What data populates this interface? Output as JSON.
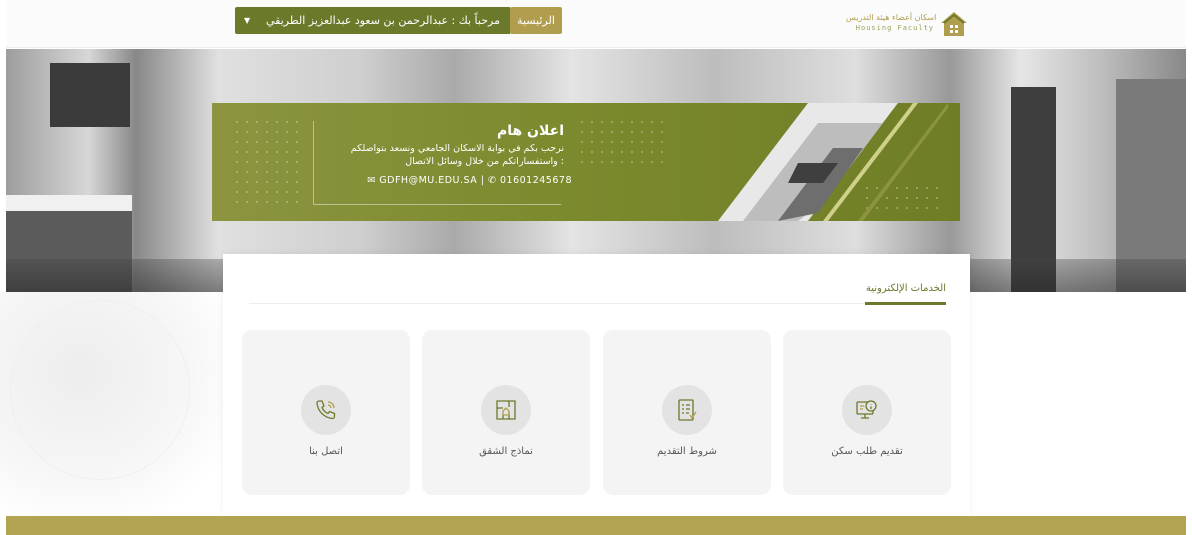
{
  "header": {
    "home_label": "الرئيسية",
    "welcome_label": "مرحباً بك : عبدالرحمن بن سعود عبدالعزيز الطريقي",
    "logo_ar": "اسكان أعضاء هيئة التدريس",
    "logo_en": "Housing Faculty"
  },
  "banner": {
    "title": "اعلان هام",
    "line1": "نرحب بكم في بوابة الاسكان الجامعي ونسعد بتواصلكم",
    "line2": "واستفساراتكم من خلال وسائل الاتصال :",
    "email": "GDFH@MU.EDU.SA",
    "phone": "01601245678",
    "separator": "|"
  },
  "services": {
    "title": "الخدمات الإلكترونية",
    "items": [
      {
        "label": "تقديم طلب سكن",
        "icon": "monitor-info-icon"
      },
      {
        "label": "شروط التقديم",
        "icon": "checklist-icon"
      },
      {
        "label": "نماذج الشقق",
        "icon": "floorplan-icon"
      },
      {
        "label": "اتصل بنا",
        "icon": "phone-icon"
      }
    ]
  },
  "colors": {
    "accent_olive": "#6b7a2a",
    "accent_gold": "#b09e4e",
    "footer_gold": "#b3a453"
  }
}
